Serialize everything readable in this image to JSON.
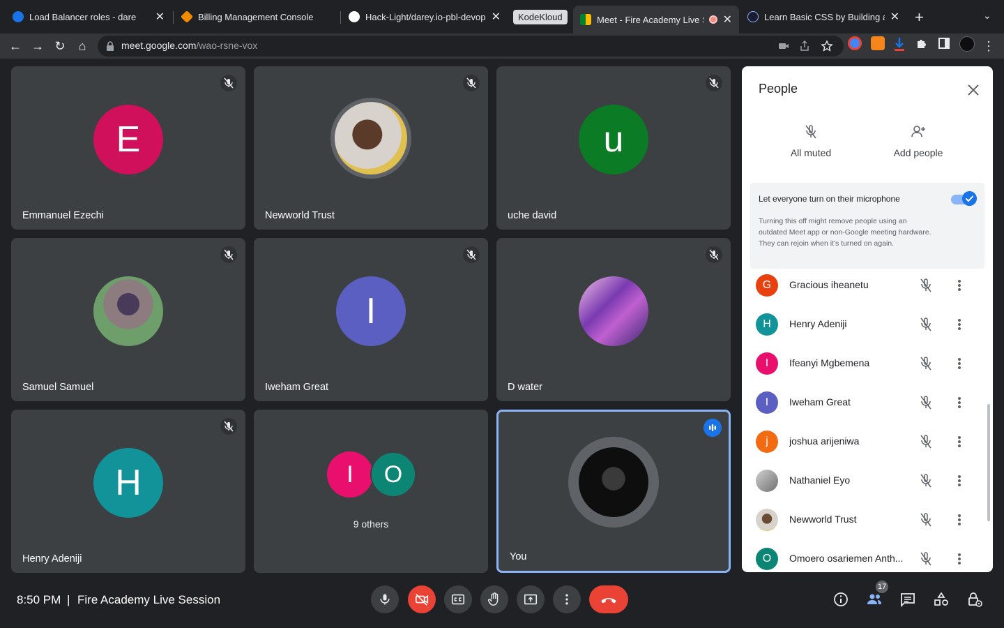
{
  "browser": {
    "tabs": [
      {
        "title": "Load Balancer roles - dare",
        "active": false
      },
      {
        "title": "Billing Management Console",
        "active": false
      },
      {
        "title": "Hack-Light/darey.io-pbl-devop",
        "active": false
      },
      {
        "title": "KodeKloud",
        "active": false
      },
      {
        "title": "Meet - Fire Academy Live S",
        "active": true
      },
      {
        "title": "Learn Basic CSS by Building a",
        "active": false
      }
    ],
    "url_host": "meet.google.com",
    "url_path": "/wao-rsne-vox"
  },
  "tiles": [
    {
      "name": "Emmanuel Ezechi",
      "initial": "E",
      "color": "#d0105a",
      "muted": true
    },
    {
      "name": "Newworld Trust",
      "initial": "",
      "photo": true,
      "muted": true
    },
    {
      "name": "uche david",
      "initial": "u",
      "color": "#0b7b25",
      "muted": true
    },
    {
      "name": "Samuel Samuel",
      "initial": "",
      "photo": true,
      "muted": true
    },
    {
      "name": "Iweham Great",
      "initial": "I",
      "color": "#5c5fc2",
      "muted": true
    },
    {
      "name": "D water",
      "initial": "",
      "photo": true,
      "muted": true
    },
    {
      "name": "Henry Adeniji",
      "initial": "H",
      "color": "#12939a",
      "muted": true
    },
    {
      "others_label": "9 others",
      "initials": [
        "I",
        "O"
      ],
      "colors": [
        "#e8106c",
        "#0d8575"
      ]
    },
    {
      "name": "You",
      "speaking": true
    }
  ],
  "people_panel": {
    "title": "People",
    "all_muted": "All muted",
    "add_people": "Add people",
    "setting_title": "Let everyone turn on their microphone",
    "setting_desc": "Turning this off might remove people using an outdated Meet app or non-Google meeting hardware. They can rejoin when it's turned on again.",
    "setting_on": true,
    "people": [
      {
        "name": "Gracious iheanetu",
        "initial": "G",
        "color": "#e8400f"
      },
      {
        "name": "Henry Adeniji",
        "initial": "H",
        "color": "#12939a"
      },
      {
        "name": "Ifeanyi Mgbemena",
        "initial": "I",
        "color": "#e8106c"
      },
      {
        "name": "Iweham Great",
        "initial": "I",
        "color": "#5c5fc2"
      },
      {
        "name": "joshua arijeniwa",
        "initial": "j",
        "color": "#f26a12"
      },
      {
        "name": "Nathaniel Eyo",
        "initial": "",
        "color": "#9e9e9e"
      },
      {
        "name": "Newworld Trust",
        "initial": "",
        "color": "#b08a6a"
      },
      {
        "name": "Omoero osariemen Anth...",
        "initial": "O",
        "color": "#0d8575"
      }
    ]
  },
  "bottom": {
    "time": "8:50 PM",
    "divider": "|",
    "meeting_title": "Fire Academy Live Session",
    "people_count": "17"
  }
}
